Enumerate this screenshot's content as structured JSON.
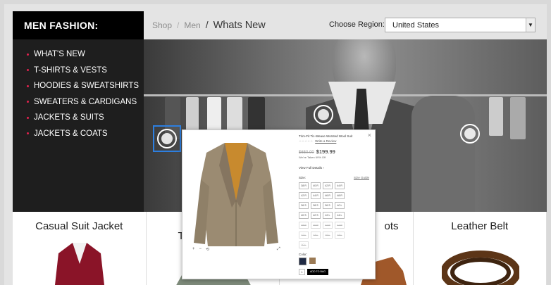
{
  "sidebar": {
    "title": "MEN FASHION:",
    "items": [
      {
        "label": "WHAT'S NEW"
      },
      {
        "label": "T-SHIRTS & VESTS"
      },
      {
        "label": "HOODIES & SWEATSHIRTS"
      },
      {
        "label": "SWEATERS & CARDIGANS"
      },
      {
        "label": "JACKETS & SUITS"
      },
      {
        "label": "JACKETS & COATS"
      }
    ]
  },
  "breadcrumb": {
    "shop": "Shop",
    "sep": "/",
    "men": "Men",
    "current": "Whats New"
  },
  "region": {
    "label": "Choose Region:",
    "selected": "United States"
  },
  "hero": {
    "hotspot_icons": [
      "hotspot-left",
      "hotspot-center",
      "hotspot-right"
    ]
  },
  "colors": {
    "accent_dot": "#e0224e",
    "select_outline": "#2d7fe0"
  },
  "popup": {
    "title": "Trim-Fit Tic-Weave Worsted Wool Suit",
    "review_link": "Write a Review",
    "price_was": "$650.00",
    "price_now": "$199.99",
    "discount": "We've Taken 69% Off",
    "full_details": "View Full Details ›",
    "size_label": "Size:",
    "size_guide": "Size Guide",
    "sizes": [
      {
        "label": "38 R"
      },
      {
        "label": "40 R"
      },
      {
        "label": "42 R"
      },
      {
        "label": "44 R"
      },
      {
        "label": "42 R"
      },
      {
        "label": "44 R"
      },
      {
        "label": "46 R"
      },
      {
        "label": "48 R"
      },
      {
        "label": "36 S"
      },
      {
        "label": "38 S"
      },
      {
        "label": "36 S"
      },
      {
        "label": "40 L"
      },
      {
        "label": "40 S"
      },
      {
        "label": "42 S"
      },
      {
        "label": "42 L"
      },
      {
        "label": "44 L"
      }
    ],
    "unavailable_sizes": [
      {
        "label": "38 R"
      },
      {
        "label": "40 R"
      },
      {
        "label": "42 R"
      },
      {
        "label": "44 R"
      },
      {
        "label": "42 L"
      },
      {
        "label": "44 L"
      },
      {
        "label": "46 L"
      },
      {
        "label": "48 L"
      },
      {
        "label": "50 L"
      }
    ],
    "color_label": "Color:",
    "qty": "1",
    "add_to_bag": "ADD TO BAG",
    "close_icon": "×",
    "zoom_in": "+",
    "zoom_out": "−",
    "reset": "⟲",
    "expand": "⤢"
  },
  "cards": [
    {
      "name": "Casual Suit Jacket"
    },
    {
      "name": "T"
    },
    {
      "name": "ots"
    },
    {
      "name": "Leather Belt"
    }
  ]
}
